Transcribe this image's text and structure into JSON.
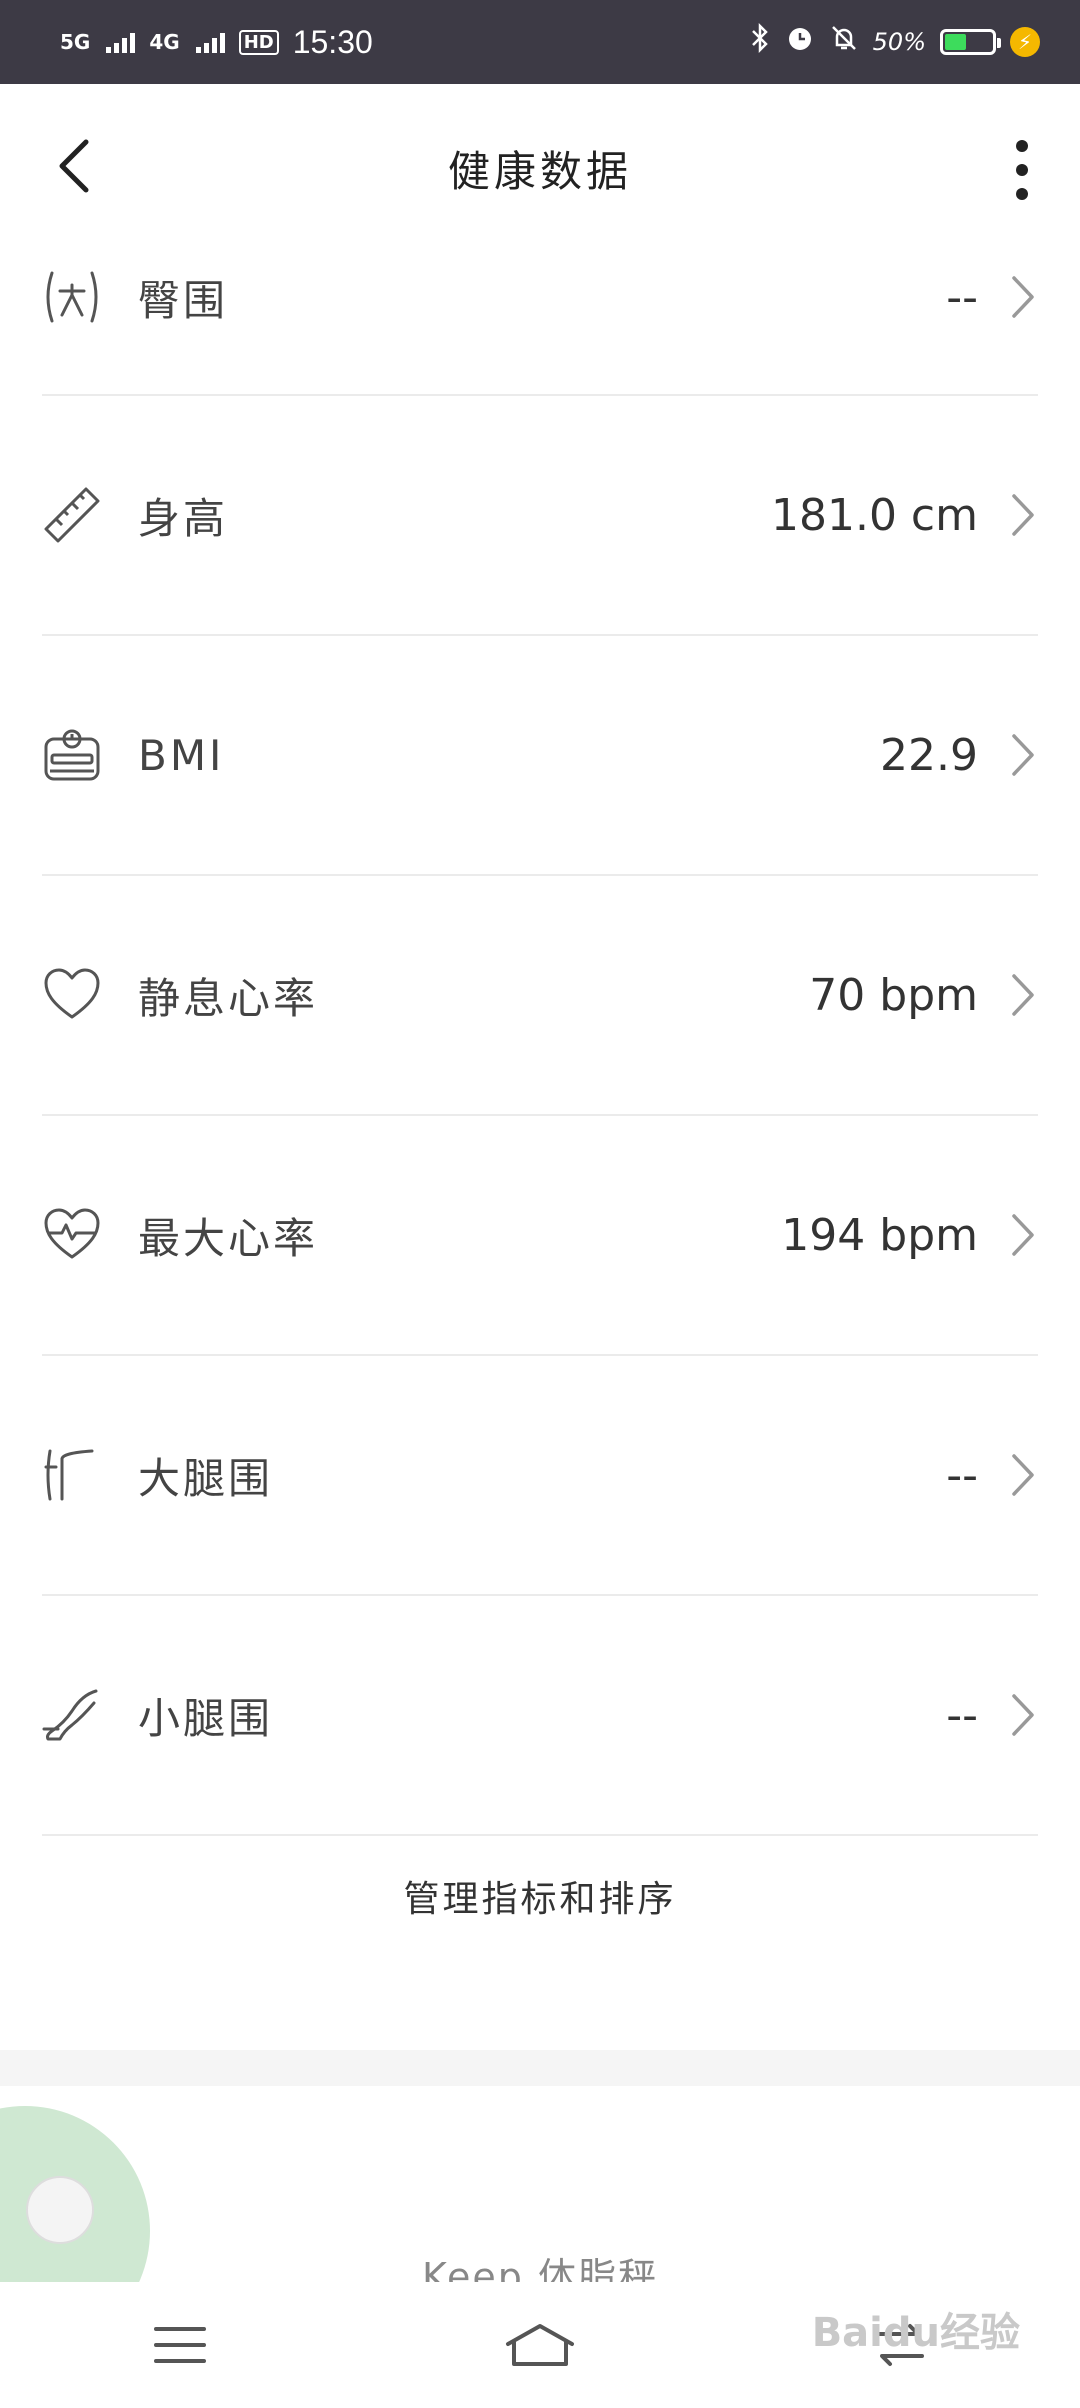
{
  "status_bar": {
    "net1": "5G",
    "net2": "4G",
    "hd": "HD",
    "time": "15:30",
    "battery_pct": "50%",
    "battery_level": 0.5
  },
  "app_bar": {
    "title": "健康数据"
  },
  "rows": [
    {
      "label": "臀围",
      "value": "--",
      "icon": "hip-icon"
    },
    {
      "label": "身高",
      "value": "181.0 cm",
      "icon": "ruler-icon"
    },
    {
      "label": "BMI",
      "value": "22.9",
      "icon": "scale-icon"
    },
    {
      "label": "静息心率",
      "value": "70 bpm",
      "icon": "heart-icon"
    },
    {
      "label": "最大心率",
      "value": "194 bpm",
      "icon": "heart-pulse-icon"
    },
    {
      "label": "大腿围",
      "value": "--",
      "icon": "thigh-icon"
    },
    {
      "label": "小腿围",
      "value": "--",
      "icon": "calf-icon"
    }
  ],
  "manage_label": "管理指标和排序",
  "device": {
    "title": "Keep 体脂秤"
  },
  "watermark": "Baidu经验",
  "colors": {
    "status_bg": "#3d3a45",
    "battery": "#3ddc5c",
    "charge": "#f5b800",
    "divider": "#ebebeb",
    "device_accent": "#cfe8d2"
  }
}
